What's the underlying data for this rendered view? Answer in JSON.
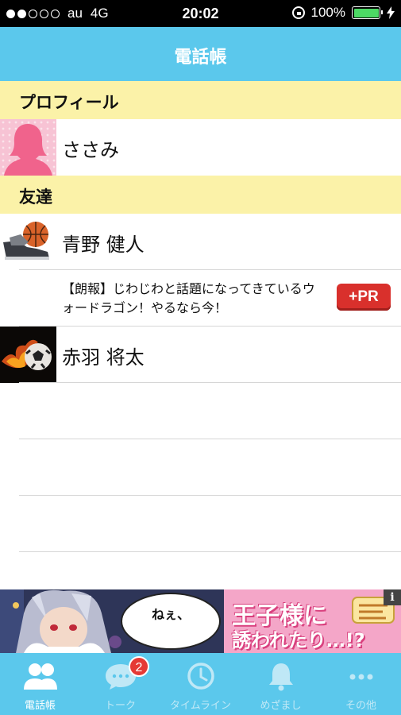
{
  "status_bar": {
    "carrier": "au",
    "network": "4G",
    "time": "20:02",
    "battery": "100%",
    "signal_bars_filled": 2,
    "signal_bars_total": 5
  },
  "header": {
    "title": "電話帳"
  },
  "profile_section": {
    "label": "プロフィール",
    "user": {
      "name": "ささみ"
    }
  },
  "friends_section": {
    "label": "友達",
    "friends": [
      {
        "name": "青野 健人",
        "avatar": "basketball-shoes"
      },
      {
        "name": "赤羽 将太",
        "avatar": "flaming-soccer-ball"
      }
    ],
    "pr": {
      "text": "【朗報】じわじわと話題になってきているウォードラゴン！やるなら今！",
      "button": "+PR"
    }
  },
  "ad_banner": {
    "speech": "ねぇ、",
    "headline_line1": "王子様に",
    "headline_line2": "誘われたり…!?",
    "info": "i"
  },
  "tab_bar": {
    "tabs": [
      {
        "label": "電話帳",
        "icon": "contacts-icon",
        "active": true
      },
      {
        "label": "トーク",
        "icon": "chat-icon",
        "badge": "2"
      },
      {
        "label": "タイムライン",
        "icon": "clock-icon"
      },
      {
        "label": "めざまし",
        "icon": "bell-icon"
      },
      {
        "label": "その他",
        "icon": "more-icon"
      }
    ]
  },
  "colors": {
    "accent": "#5bc8ec",
    "section_header": "#fbf2a8",
    "pr_button": "#d9302c",
    "badge": "#e53935"
  }
}
